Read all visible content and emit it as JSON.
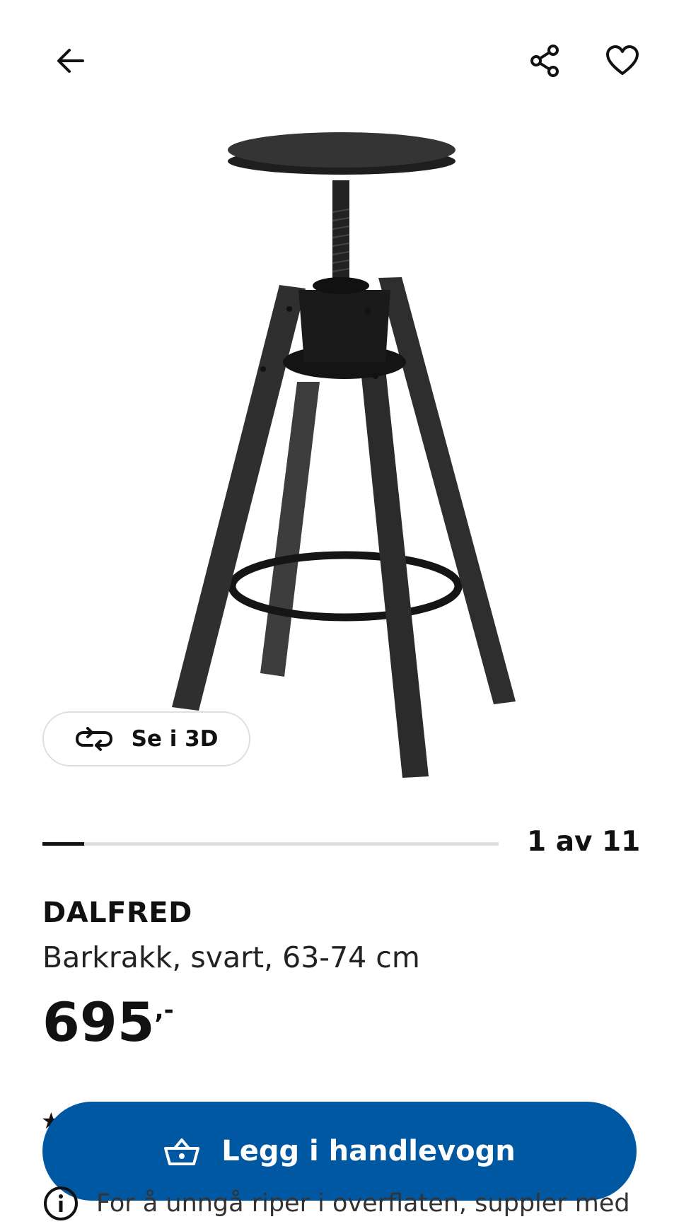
{
  "header": {
    "back_icon": "arrow-left-icon",
    "share_icon": "share-icon",
    "favorite_icon": "heart-icon"
  },
  "gallery": {
    "view_3d_label": "Se i 3D",
    "view_3d_icon": "rotate-3d-icon",
    "current": 1,
    "total": 11,
    "pager_text": "1 av 11"
  },
  "product": {
    "name": "DALFRED",
    "description": "Barkrakk, svart, 63-74 cm",
    "price": "695",
    "price_suffix": ",-"
  },
  "cart_button": {
    "label": "Legg i handlevogn",
    "icon": "basket-icon",
    "color": "#0058a3"
  },
  "info": {
    "icon": "info-icon",
    "text": "For å unngå riper i overflaten, suppler med"
  }
}
